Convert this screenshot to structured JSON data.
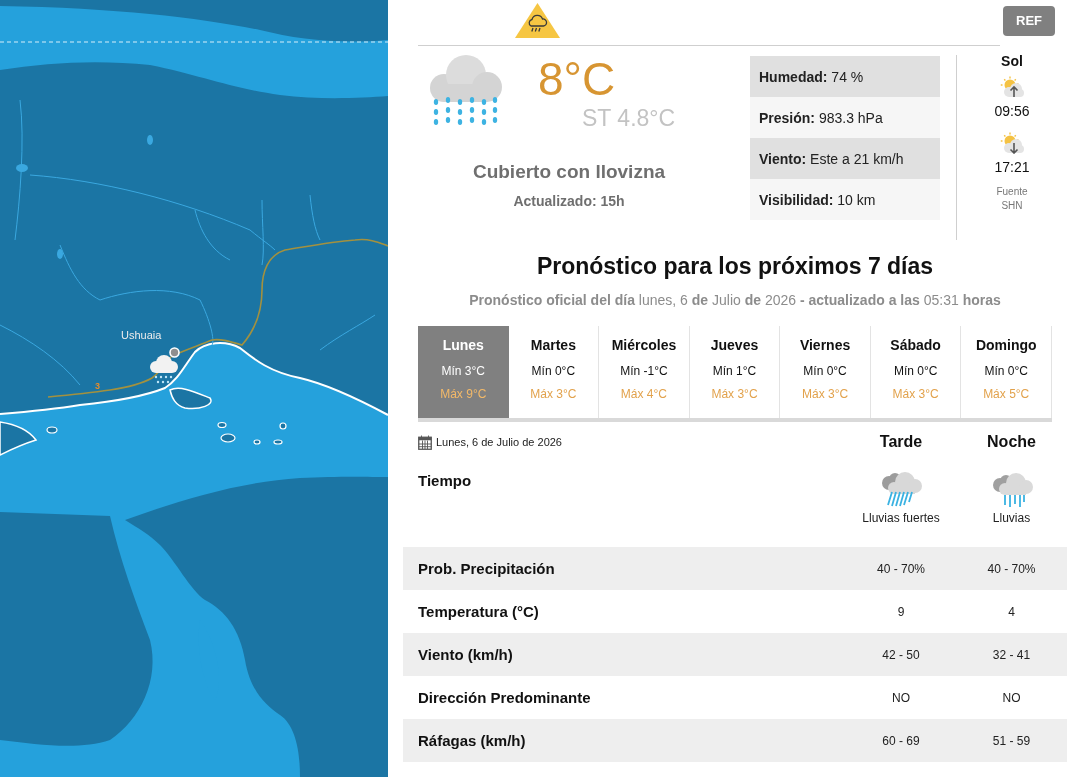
{
  "map": {
    "place_label": "Ushuaia",
    "route_label": "3"
  },
  "header": {
    "ref_button": "REF"
  },
  "current": {
    "temperature": "8°C",
    "feels_like": "ST 4.8°C",
    "condition": "Cubierto con llovizna",
    "updated": "Actualizado: 15h"
  },
  "details": [
    "**Humedad:** 74 %",
    "**Presión:** 983.3 hPa",
    "**Viento:** Este a 21 km/h",
    "**Visibilidad:** 10 km"
  ],
  "sun": {
    "title": "Sol",
    "sunrise": "09:56",
    "sunset": "17:21",
    "source_label": "Fuente",
    "source_name": "SHN"
  },
  "forecast": {
    "title": "Pronóstico para los próximos 7 días",
    "subtitle": "**Pronóstico oficial del día** lunes, 6 **de** Julio **de** 2026 **- actualizado a las** 05:31 **horas**",
    "days": [
      {
        "name": "Lunes",
        "min": "Mín 3°C",
        "max": "Máx 9°C",
        "selected": true
      },
      {
        "name": "Martes",
        "min": "Mín 0°C",
        "max": "Máx 3°C",
        "selected": false
      },
      {
        "name": "Miércoles",
        "min": "Mín -1°C",
        "max": "Máx 4°C",
        "selected": false
      },
      {
        "name": "Jueves",
        "min": "Mín 1°C",
        "max": "Máx 3°C",
        "selected": false
      },
      {
        "name": "Viernes",
        "min": "Mín 0°C",
        "max": "Máx 3°C",
        "selected": false
      },
      {
        "name": "Sábado",
        "min": "Mín 0°C",
        "max": "Máx 3°C",
        "selected": false
      },
      {
        "name": "Domingo",
        "min": "Mín 0°C",
        "max": "Máx 5°C",
        "selected": false
      }
    ],
    "date": "Lunes, 6 de Julio de 2026",
    "periods": [
      "Tarde",
      "Noche"
    ],
    "weather_label": "Tiempo",
    "weather": [
      {
        "kind": "downpour",
        "description": "Lluvias fuertes"
      },
      {
        "kind": "rain",
        "description": "Lluvias"
      }
    ],
    "rows": [
      {
        "label": "Prob. Precipitación",
        "values": [
          "40 - 70%",
          "40 - 70%"
        ]
      },
      {
        "label": "Temperatura (°C)",
        "values": [
          "9",
          "4"
        ]
      },
      {
        "label": "Viento (km/h)",
        "values": [
          "42 - 50",
          "32 - 41"
        ]
      },
      {
        "label": "Dirección Predominante",
        "values": [
          "NO",
          "NO"
        ]
      },
      {
        "label": "Ráfagas (km/h)",
        "values": [
          "60 - 69",
          "51 - 59"
        ]
      }
    ]
  }
}
